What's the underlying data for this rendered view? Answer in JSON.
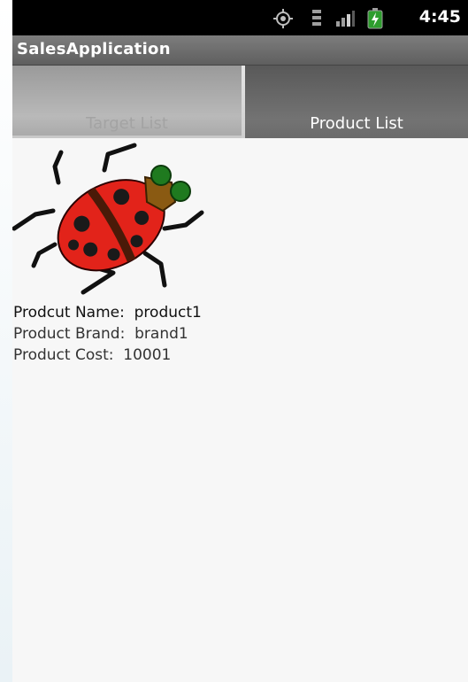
{
  "status_bar": {
    "time": "4:45",
    "icons": [
      "gps-icon",
      "data-3g-icon",
      "signal-icon",
      "battery-charging-icon"
    ]
  },
  "app": {
    "title": "SalesApplication"
  },
  "tabs": [
    {
      "label": "Target List",
      "selected": false
    },
    {
      "label": "Product List",
      "selected": true
    }
  ],
  "product": {
    "image": "ladybug-icon",
    "lines": [
      "Prodcut Name:  product1",
      "Product Brand:  brand1",
      "Product Cost:  10001"
    ]
  },
  "colors": {
    "accent_selected_tab": "#6b6b6b",
    "unselected_tab": "#b3b3b3",
    "background": "#f7f7f7"
  }
}
